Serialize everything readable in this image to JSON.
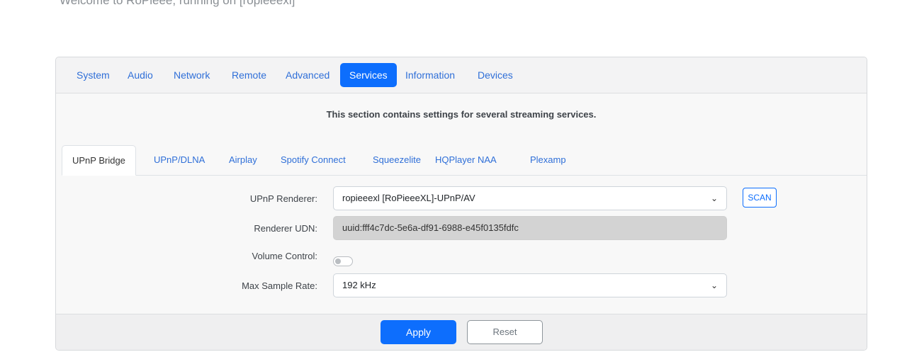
{
  "header": {
    "welcome": "Welcome to RoPieee, running on [ropieeexl]"
  },
  "main_tabs": [
    {
      "label": "System"
    },
    {
      "label": "Audio"
    },
    {
      "label": "Network"
    },
    {
      "label": "Remote"
    },
    {
      "label": "Advanced"
    },
    {
      "label": "Services",
      "active": true
    },
    {
      "label": "Information"
    },
    {
      "label": "Devices"
    }
  ],
  "services": {
    "description": "This section contains settings for several streaming services.",
    "sub_tabs": [
      {
        "label": "UPnP Bridge",
        "active": true
      },
      {
        "label": "UPnP/DLNA"
      },
      {
        "label": "Airplay"
      },
      {
        "label": "Spotify Connect"
      },
      {
        "label": "Squeezelite"
      },
      {
        "label": "HQPlayer NAA"
      },
      {
        "label": "Plexamp"
      }
    ]
  },
  "form": {
    "renderer_label": "UPnP Renderer:",
    "renderer_value": "ropieeexl [RoPieeeXL]-UPnP/AV",
    "scan_label": "SCAN",
    "udn_label": "Renderer UDN:",
    "udn_value": "uuid:fff4c7dc-5e6a-df91-6988-e45f0135fdfc",
    "volume_label": "Volume Control:",
    "volume_enabled": false,
    "rate_label": "Max Sample Rate:",
    "rate_value": "192 kHz"
  },
  "footer": {
    "apply_label": "Apply",
    "reset_label": "Reset"
  },
  "icons": {
    "dropdown": "chevron-down-icon"
  },
  "colors": {
    "accent": "#0d6efd",
    "readonly_bg": "#d3d3d3"
  }
}
